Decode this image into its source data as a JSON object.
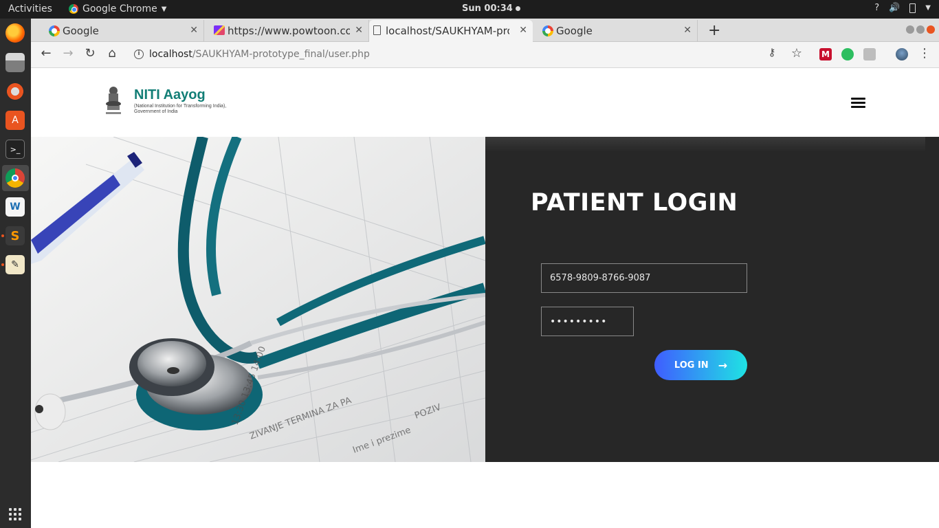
{
  "system": {
    "activities": "Activities",
    "app_name": "Google Chrome",
    "clock": "Sun 00:34",
    "tray_help": "?"
  },
  "browser": {
    "tabs": [
      {
        "title": "Google",
        "icon": "google-icon"
      },
      {
        "title": "https://www.powtoon.co",
        "icon": "powtoon-icon"
      },
      {
        "title": "localhost/SAUKHYAM-pro",
        "icon": "page-icon",
        "active": true
      },
      {
        "title": "Google",
        "icon": "google-icon"
      }
    ],
    "url_host": "localhost",
    "url_path": "/SAUKHYAM-prototype_final/user.php"
  },
  "page": {
    "brand_name": "NITI Aayog",
    "brand_sub_line1": "(National Institution for Transforming India),",
    "brand_sub_line2": "Government of India",
    "login_title": "PATIENT LOGIN",
    "id_value": "6578-9809-8766-9087",
    "password_value": "•••••••••",
    "login_button": "LOG IN",
    "button_arrow": "→",
    "accent_colors": {
      "brand_green": "#127e76",
      "panel_bg": "#272727",
      "button_start": "#3f5dff",
      "button_end": "#1fe3e3"
    }
  }
}
